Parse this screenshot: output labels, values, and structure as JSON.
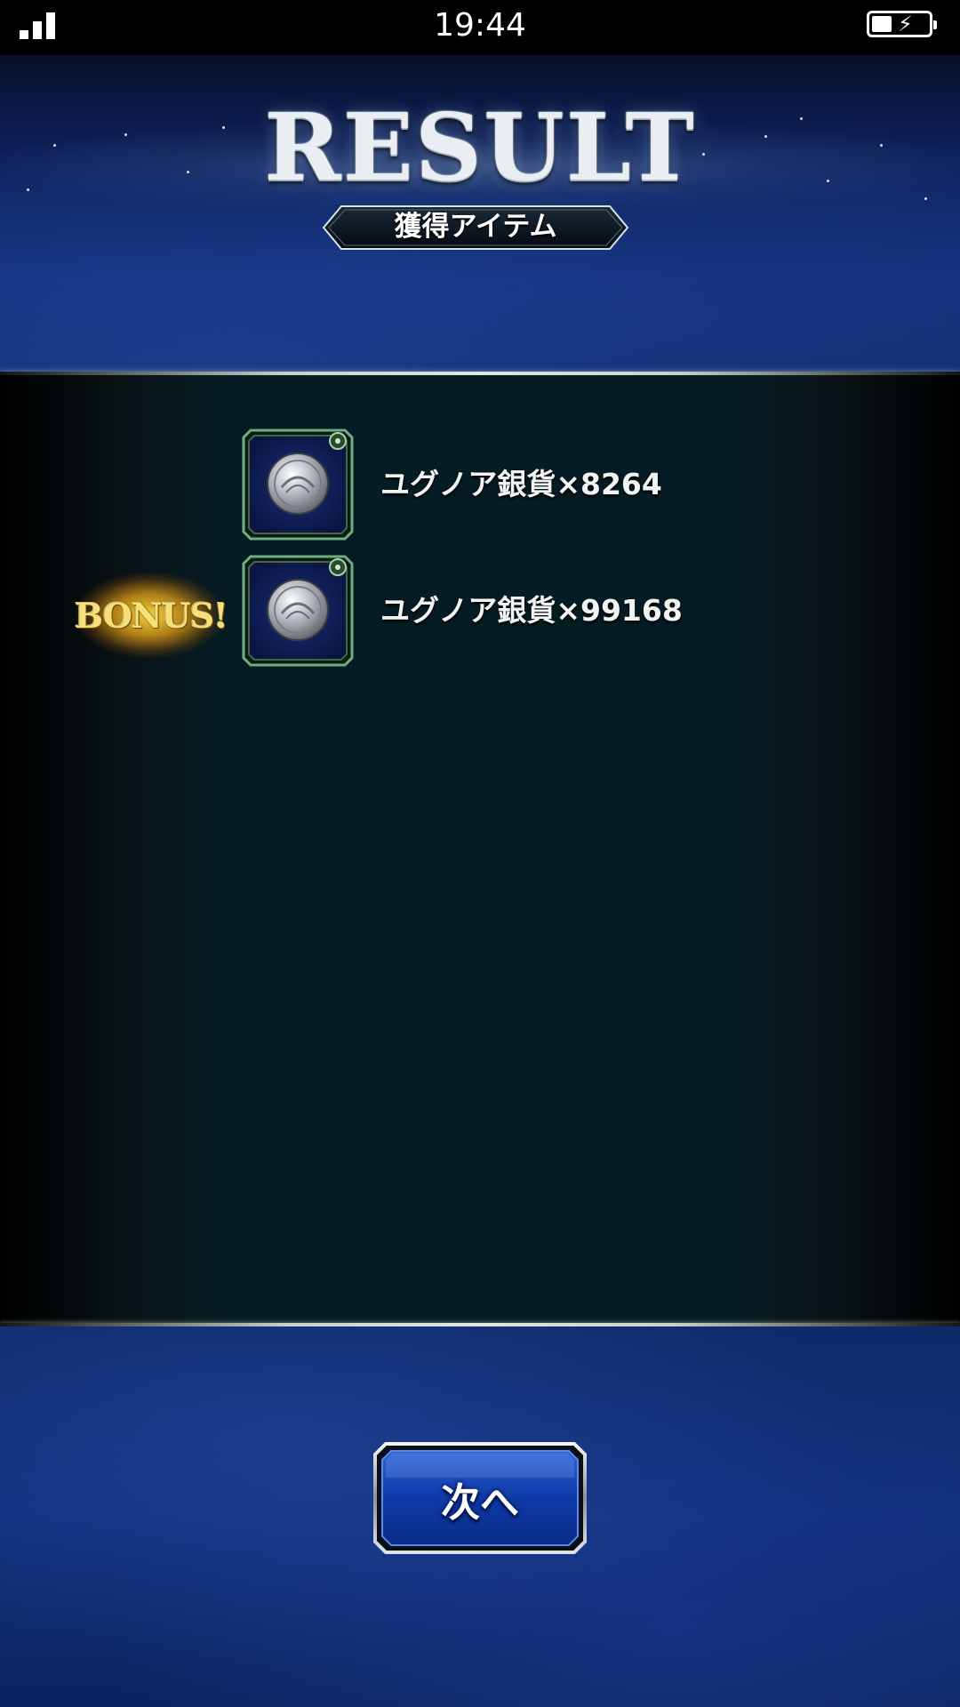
{
  "status_bar": {
    "time": "19:44",
    "signal_icon": "signal-bars-icon",
    "battery_icon": "battery-charging-icon",
    "battery_bolt": "⚡"
  },
  "header": {
    "title": "RESULT",
    "subtitle": "獲得アイテム"
  },
  "items": [
    {
      "icon": "silver-coin-icon",
      "label": "ユグノア銀貨×8264",
      "bonus": false
    },
    {
      "icon": "silver-coin-icon",
      "label": "ユグノア銀貨×99168",
      "bonus": true,
      "bonus_label": "BONUS!"
    }
  ],
  "footer": {
    "next_button_label": "次へ"
  },
  "colors": {
    "header_blue": "#13307a",
    "panel_teal": "#061c24",
    "frame_green": "#6fae80",
    "bonus_gold": "#f6e07a"
  }
}
